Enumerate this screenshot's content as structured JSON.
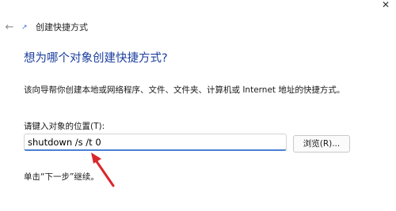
{
  "window": {
    "title": "创建快捷方式",
    "back_icon": "back-arrow-icon",
    "app_icon": "shortcut-icon",
    "close_icon": "close-icon"
  },
  "main": {
    "heading": "想为哪个对象创建快捷方式?",
    "description": "该向导帮你创建本地或网络程序、文件、文件夹、计算机或 Internet 地址的快捷方式。",
    "field_label": "请键入对象的位置(T):",
    "location_value": "shutdown /s /t 0",
    "browse_label": "浏览(R)...",
    "hint": "单击“下一步”继续。"
  },
  "colors": {
    "heading": "#1b3e9e",
    "annotation_arrow": "#d9262c",
    "input_focus": "#4a7fd4"
  }
}
